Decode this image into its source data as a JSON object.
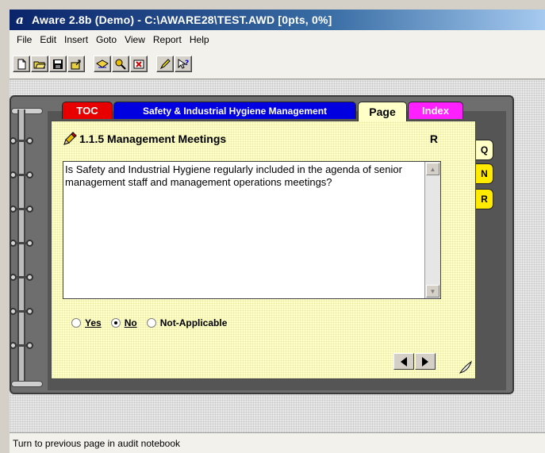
{
  "window": {
    "title": "Aware 2.8b (Demo) - C:\\AWARE28\\TEST.AWD [0pts, 0%]"
  },
  "menu": {
    "items": [
      "File",
      "Edit",
      "Insert",
      "Goto",
      "View",
      "Report",
      "Help"
    ]
  },
  "toolbar": {
    "icons": [
      "new-icon",
      "open-icon",
      "save-icon",
      "export-icon",
      "mail-icon",
      "search-key-icon",
      "delete-item-icon",
      "highlighter-icon",
      "context-help-icon"
    ]
  },
  "notebook": {
    "tabs": {
      "toc": "TOC",
      "section": "Safety & Industrial Hygiene Management",
      "page": "Page",
      "index": "Index"
    },
    "side_tabs": [
      "Q",
      "N",
      "R"
    ],
    "heading": "1.1.5 Management Meetings",
    "rating_label": "R",
    "question": "Is Safety and Industrial Hygiene regularly included in the agenda of senior management staff and management operations meetings?",
    "answers": {
      "yes": "Yes",
      "no": "No",
      "na": "Not-Applicable",
      "selected": "No"
    }
  },
  "status": {
    "text": "Turn to previous page in audit notebook"
  },
  "colors": {
    "toc": "#e80000",
    "section": "#0000e0",
    "index": "#ff20ff",
    "page": "#ffffc8",
    "side_tab_active": "#ffea00"
  }
}
